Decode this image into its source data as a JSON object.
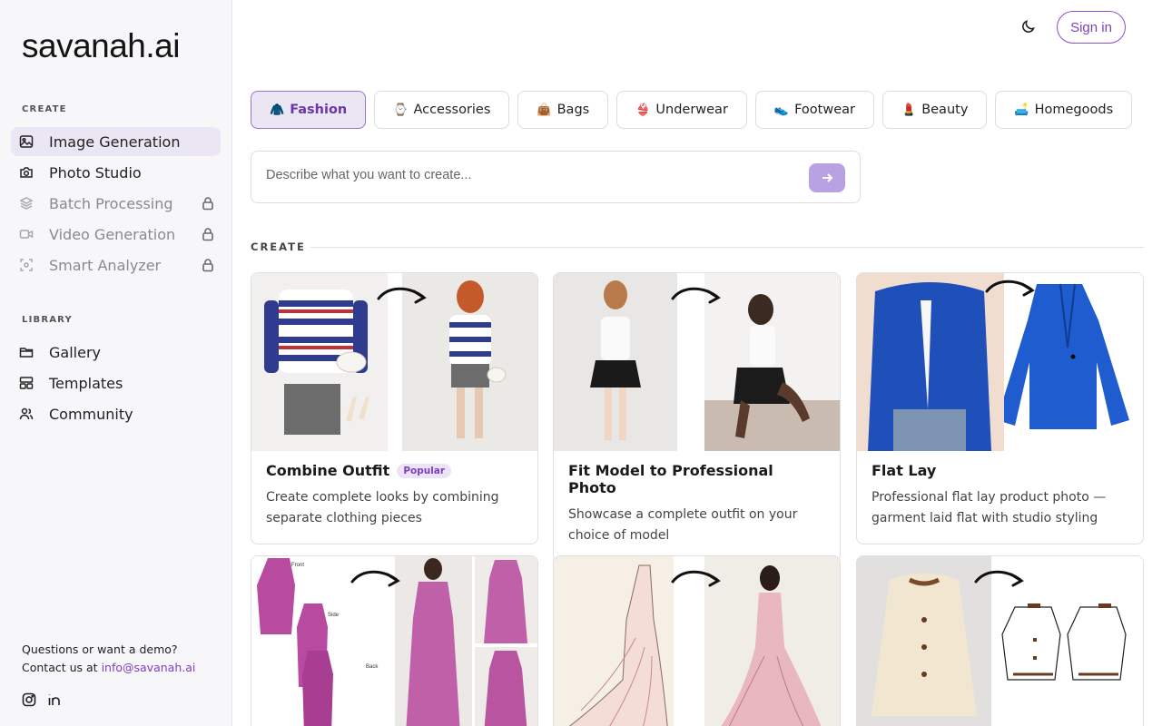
{
  "brand": {
    "logo": "savanah.ai"
  },
  "sidebar": {
    "create_label": "CREATE",
    "create_items": [
      {
        "label": "Image Generation",
        "icon": "image-icon",
        "active": true,
        "locked": false
      },
      {
        "label": "Photo Studio",
        "icon": "camera-icon",
        "active": false,
        "locked": false
      },
      {
        "label": "Batch Processing",
        "icon": "layers-icon",
        "active": false,
        "locked": true
      },
      {
        "label": "Video Generation",
        "icon": "video-icon",
        "active": false,
        "locked": true
      },
      {
        "label": "Smart Analyzer",
        "icon": "scan-icon",
        "active": false,
        "locked": true
      }
    ],
    "library_label": "LIBRARY",
    "library_items": [
      {
        "label": "Gallery",
        "icon": "folder-icon"
      },
      {
        "label": "Templates",
        "icon": "templates-icon"
      },
      {
        "label": "Community",
        "icon": "users-icon"
      }
    ],
    "contact_line1": "Questions or want a demo?",
    "contact_prefix": "Contact us at ",
    "contact_email": "info@savanah.ai"
  },
  "header": {
    "signin_label": "Sign in"
  },
  "categories": [
    {
      "emoji": "🧥",
      "label": "Fashion",
      "active": true
    },
    {
      "emoji": "⌚",
      "label": "Accessories",
      "active": false
    },
    {
      "emoji": "👜",
      "label": "Bags",
      "active": false
    },
    {
      "emoji": "👙",
      "label": "Underwear",
      "active": false
    },
    {
      "emoji": "👟",
      "label": "Footwear",
      "active": false
    },
    {
      "emoji": "💄",
      "label": "Beauty",
      "active": false
    },
    {
      "emoji": "🛋️",
      "label": "Homegoods",
      "active": false
    }
  ],
  "prompt": {
    "placeholder": "Describe what you want to create..."
  },
  "section": {
    "title": "CREATE"
  },
  "cards": [
    {
      "title": "Combine Outfit",
      "badge": "Popular",
      "desc": "Create complete looks by combining separate clothing pieces"
    },
    {
      "title": "Fit Model to Professional Photo",
      "badge": "",
      "desc": "Showcase a complete outfit on your choice of model"
    },
    {
      "title": "Flat Lay",
      "badge": "",
      "desc": "Professional flat lay product photo — garment laid flat with studio styling"
    },
    {
      "title": "",
      "badge": "",
      "desc": "",
      "labels": [
        "Front",
        "Side",
        "Back"
      ]
    },
    {
      "title": "",
      "badge": "",
      "desc": ""
    },
    {
      "title": "",
      "badge": "",
      "desc": ""
    }
  ],
  "colors": {
    "accent": "#7c3fbf",
    "active_bg": "#ebe6f3",
    "send_button": "#b9a2e4"
  }
}
